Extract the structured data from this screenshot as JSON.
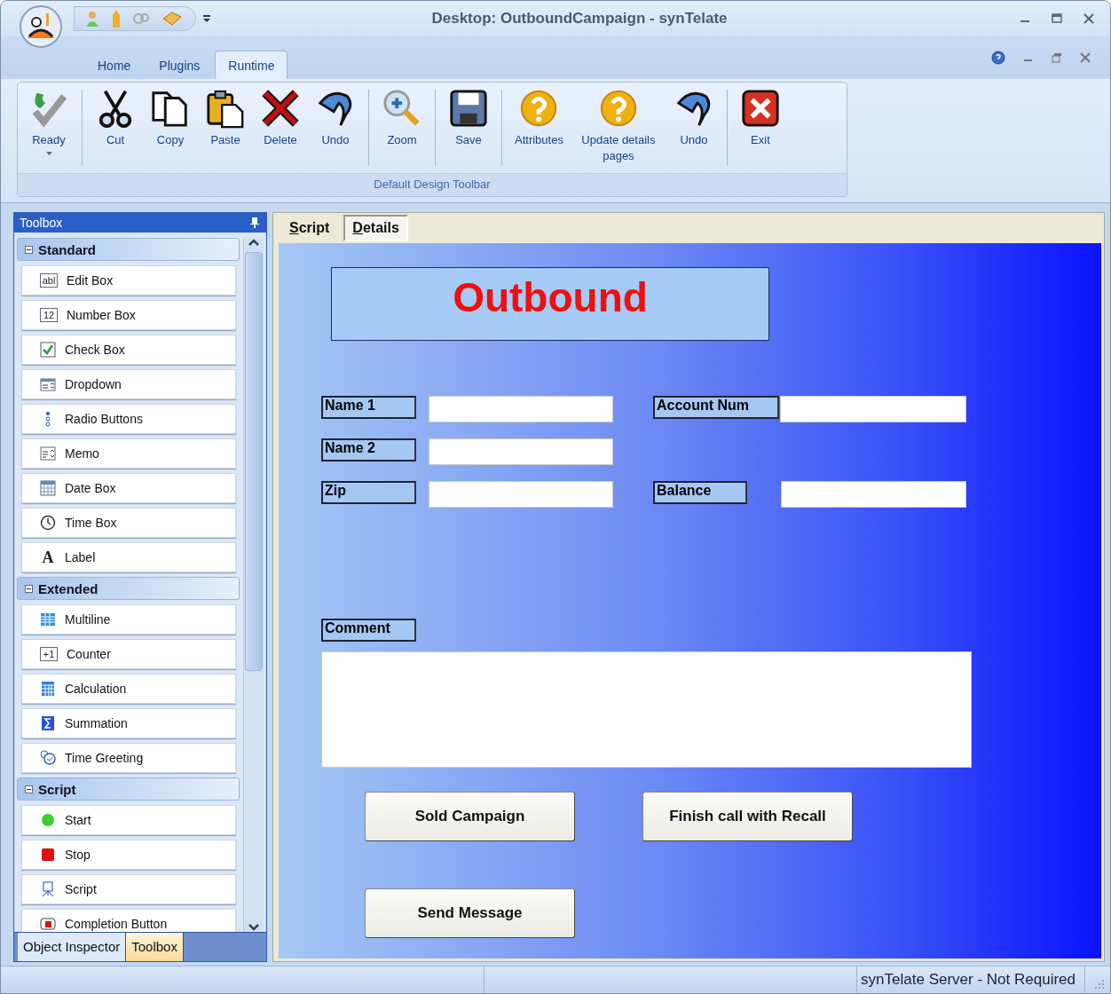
{
  "window": {
    "title": "Desktop: OutboundCampaign - synTelate"
  },
  "ribbon_tabs": [
    {
      "label": "Home",
      "selected": false
    },
    {
      "label": "Plugins",
      "selected": false
    },
    {
      "label": "Runtime",
      "selected": true
    }
  ],
  "toolbar": {
    "title": "Default Design Toolbar",
    "groups": [
      {
        "buttons": [
          {
            "label": "Ready",
            "dropdown": true
          }
        ]
      },
      {
        "buttons": [
          {
            "label": "Cut",
            "dropdown": false
          },
          {
            "label": "Copy",
            "dropdown": false
          },
          {
            "label": "Paste",
            "dropdown": false
          },
          {
            "label": "Delete",
            "dropdown": false
          },
          {
            "label": "Undo",
            "dropdown": false
          }
        ]
      },
      {
        "buttons": [
          {
            "label": "Zoom",
            "dropdown": false
          }
        ]
      },
      {
        "buttons": [
          {
            "label": "Save",
            "dropdown": false
          }
        ]
      },
      {
        "buttons": [
          {
            "label": "Attributes",
            "dropdown": false
          },
          {
            "label": "Update details pages",
            "dropdown": false
          },
          {
            "label": "Undo",
            "dropdown": false
          }
        ]
      },
      {
        "buttons": [
          {
            "label": "Exit",
            "dropdown": false
          }
        ]
      }
    ]
  },
  "toolbox": {
    "title": "Toolbox",
    "sections": [
      {
        "label": "Standard",
        "expanded": true,
        "items": [
          {
            "label": "Edit Box",
            "icon_text": "abl"
          },
          {
            "label": "Number Box",
            "icon_text": "12"
          },
          {
            "label": "Check Box"
          },
          {
            "label": "Dropdown"
          },
          {
            "label": "Radio Buttons"
          },
          {
            "label": "Memo"
          },
          {
            "label": "Date Box"
          },
          {
            "label": "Time Box"
          },
          {
            "label": "Label",
            "icon_text": "A"
          }
        ]
      },
      {
        "label": "Extended",
        "expanded": true,
        "items": [
          {
            "label": "Multiline"
          },
          {
            "label": "Counter",
            "icon_text": "+1"
          },
          {
            "label": "Calculation"
          },
          {
            "label": "Summation"
          },
          {
            "label": "Time Greeting"
          }
        ]
      },
      {
        "label": "Script",
        "expanded": true,
        "items": [
          {
            "label": "Start"
          },
          {
            "label": "Stop"
          },
          {
            "label": "Script"
          },
          {
            "label": "Completion Button"
          }
        ]
      }
    ],
    "bottom_tabs": [
      {
        "label": "Object Inspector",
        "selected": false
      },
      {
        "label": "Toolbox",
        "selected": true
      }
    ]
  },
  "page_tabs": [
    {
      "label": "Script",
      "selected": false
    },
    {
      "label": "Details",
      "selected": true
    }
  ],
  "form": {
    "title": "Outbound",
    "fields": [
      {
        "label": "Name 1"
      },
      {
        "label": "Name 2"
      },
      {
        "label": "Zip"
      },
      {
        "label": "Account Num"
      },
      {
        "label": "Balance"
      }
    ],
    "comment": {
      "label": "Comment"
    },
    "buttons": [
      "Sold Campaign",
      "Finish call with Recall",
      "Send Message"
    ]
  },
  "status_bar": {
    "text": "synTelate Server - Not Required"
  }
}
